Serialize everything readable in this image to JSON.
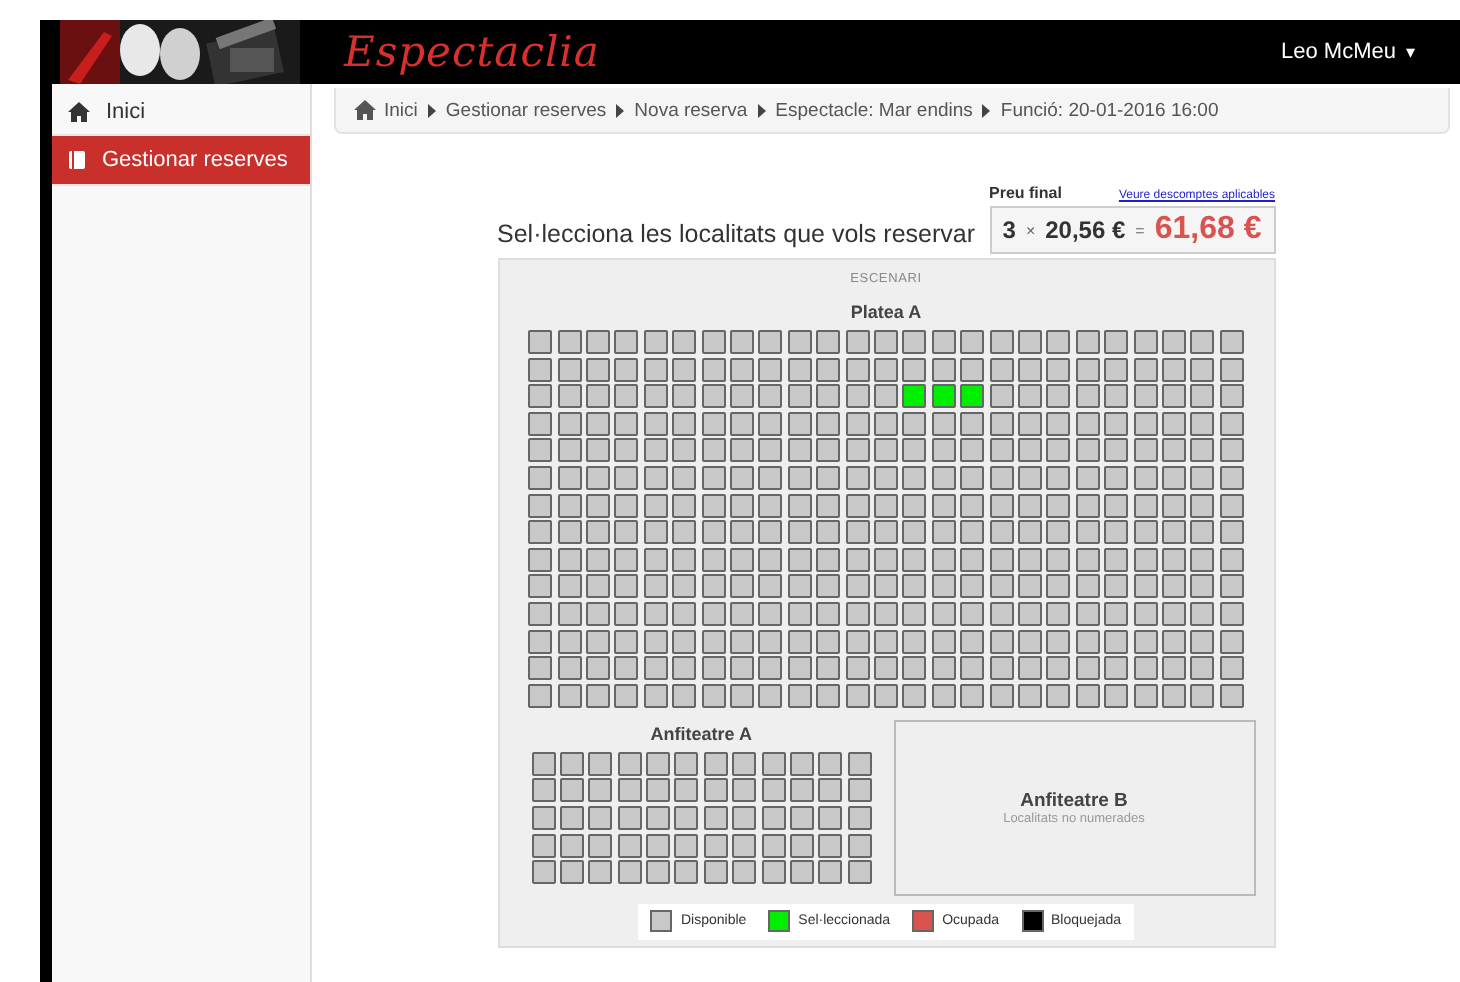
{
  "header": {
    "brand": "Espectaclia",
    "user": "Leo McMeu",
    "user_caret": "▾"
  },
  "sidebar": {
    "items": [
      {
        "label": "Inici",
        "selected": false
      },
      {
        "label": "Gestionar reserves",
        "selected": true
      }
    ]
  },
  "breadcrumb": [
    {
      "label": "Inici"
    },
    {
      "label": "Gestionar reserves"
    },
    {
      "label": "Nova reserva"
    },
    {
      "label": "Espectacle: Mar endins"
    },
    {
      "label": "Funció: 20-01-2016 16:00"
    }
  ],
  "heading": "Sel·lecciona les localitats que vols reservar",
  "price": {
    "label": "Preu final",
    "link": "Veure descomptes aplicables",
    "quantity": "3",
    "times": "×",
    "unit_price": "20,56 €",
    "equals": "=",
    "total": "61,68 €"
  },
  "stage": "ESCENARI",
  "platea": {
    "title": "Platea A",
    "rows": [
      [
        {
          "selected": false
        },
        {
          "selected": false
        },
        {
          "selected": false
        },
        {
          "selected": false
        },
        {
          "selected": false
        },
        {
          "selected": false
        },
        {
          "selected": false
        },
        {
          "selected": false
        },
        {
          "selected": false
        },
        {
          "selected": false
        },
        {
          "selected": false
        },
        {
          "selected": false
        },
        {
          "selected": false
        },
        {
          "selected": false
        },
        {
          "selected": false
        },
        {
          "selected": false
        },
        {
          "selected": false
        },
        {
          "selected": false
        },
        {
          "selected": false
        },
        {
          "selected": false
        },
        {
          "selected": false
        },
        {
          "selected": false
        },
        {
          "selected": false
        },
        {
          "selected": false
        },
        {
          "selected": false
        }
      ],
      [
        {
          "selected": false
        },
        {
          "selected": false
        },
        {
          "selected": false
        },
        {
          "selected": false
        },
        {
          "selected": false
        },
        {
          "selected": false
        },
        {
          "selected": false
        },
        {
          "selected": false
        },
        {
          "selected": false
        },
        {
          "selected": false
        },
        {
          "selected": false
        },
        {
          "selected": false
        },
        {
          "selected": false
        },
        {
          "selected": false
        },
        {
          "selected": false
        },
        {
          "selected": false
        },
        {
          "selected": false
        },
        {
          "selected": false
        },
        {
          "selected": false
        },
        {
          "selected": false
        },
        {
          "selected": false
        },
        {
          "selected": false
        },
        {
          "selected": false
        },
        {
          "selected": false
        },
        {
          "selected": false
        }
      ],
      [
        {
          "selected": false
        },
        {
          "selected": false
        },
        {
          "selected": false
        },
        {
          "selected": false
        },
        {
          "selected": false
        },
        {
          "selected": false
        },
        {
          "selected": false
        },
        {
          "selected": false
        },
        {
          "selected": false
        },
        {
          "selected": false
        },
        {
          "selected": false
        },
        {
          "selected": false
        },
        {
          "selected": false
        },
        {
          "selected": true
        },
        {
          "selected": true
        },
        {
          "selected": true
        },
        {
          "selected": false
        },
        {
          "selected": false
        },
        {
          "selected": false
        },
        {
          "selected": false
        },
        {
          "selected": false
        },
        {
          "selected": false
        },
        {
          "selected": false
        },
        {
          "selected": false
        },
        {
          "selected": false
        }
      ],
      [
        {
          "selected": false
        },
        {
          "selected": false
        },
        {
          "selected": false
        },
        {
          "selected": false
        },
        {
          "selected": false
        },
        {
          "selected": false
        },
        {
          "selected": false
        },
        {
          "selected": false
        },
        {
          "selected": false
        },
        {
          "selected": false
        },
        {
          "selected": false
        },
        {
          "selected": false
        },
        {
          "selected": false
        },
        {
          "selected": false
        },
        {
          "selected": false
        },
        {
          "selected": false
        },
        {
          "selected": false
        },
        {
          "selected": false
        },
        {
          "selected": false
        },
        {
          "selected": false
        },
        {
          "selected": false
        },
        {
          "selected": false
        },
        {
          "selected": false
        },
        {
          "selected": false
        },
        {
          "selected": false
        }
      ],
      [
        {
          "selected": false
        },
        {
          "selected": false
        },
        {
          "selected": false
        },
        {
          "selected": false
        },
        {
          "selected": false
        },
        {
          "selected": false
        },
        {
          "selected": false
        },
        {
          "selected": false
        },
        {
          "selected": false
        },
        {
          "selected": false
        },
        {
          "selected": false
        },
        {
          "selected": false
        },
        {
          "selected": false
        },
        {
          "selected": false
        },
        {
          "selected": false
        },
        {
          "selected": false
        },
        {
          "selected": false
        },
        {
          "selected": false
        },
        {
          "selected": false
        },
        {
          "selected": false
        },
        {
          "selected": false
        },
        {
          "selected": false
        },
        {
          "selected": false
        },
        {
          "selected": false
        },
        {
          "selected": false
        }
      ],
      [
        {
          "selected": false
        },
        {
          "selected": false
        },
        {
          "selected": false
        },
        {
          "selected": false
        },
        {
          "selected": false
        },
        {
          "selected": false
        },
        {
          "selected": false
        },
        {
          "selected": false
        },
        {
          "selected": false
        },
        {
          "selected": false
        },
        {
          "selected": false
        },
        {
          "selected": false
        },
        {
          "selected": false
        },
        {
          "selected": false
        },
        {
          "selected": false
        },
        {
          "selected": false
        },
        {
          "selected": false
        },
        {
          "selected": false
        },
        {
          "selected": false
        },
        {
          "selected": false
        },
        {
          "selected": false
        },
        {
          "selected": false
        },
        {
          "selected": false
        },
        {
          "selected": false
        },
        {
          "selected": false
        }
      ],
      [
        {
          "selected": false
        },
        {
          "selected": false
        },
        {
          "selected": false
        },
        {
          "selected": false
        },
        {
          "selected": false
        },
        {
          "selected": false
        },
        {
          "selected": false
        },
        {
          "selected": false
        },
        {
          "selected": false
        },
        {
          "selected": false
        },
        {
          "selected": false
        },
        {
          "selected": false
        },
        {
          "selected": false
        },
        {
          "selected": false
        },
        {
          "selected": false
        },
        {
          "selected": false
        },
        {
          "selected": false
        },
        {
          "selected": false
        },
        {
          "selected": false
        },
        {
          "selected": false
        },
        {
          "selected": false
        },
        {
          "selected": false
        },
        {
          "selected": false
        },
        {
          "selected": false
        },
        {
          "selected": false
        }
      ],
      [
        {
          "selected": false
        },
        {
          "selected": false
        },
        {
          "selected": false
        },
        {
          "selected": false
        },
        {
          "selected": false
        },
        {
          "selected": false
        },
        {
          "selected": false
        },
        {
          "selected": false
        },
        {
          "selected": false
        },
        {
          "selected": false
        },
        {
          "selected": false
        },
        {
          "selected": false
        },
        {
          "selected": false
        },
        {
          "selected": false
        },
        {
          "selected": false
        },
        {
          "selected": false
        },
        {
          "selected": false
        },
        {
          "selected": false
        },
        {
          "selected": false
        },
        {
          "selected": false
        },
        {
          "selected": false
        },
        {
          "selected": false
        },
        {
          "selected": false
        },
        {
          "selected": false
        },
        {
          "selected": false
        }
      ],
      [
        {
          "selected": false
        },
        {
          "selected": false
        },
        {
          "selected": false
        },
        {
          "selected": false
        },
        {
          "selected": false
        },
        {
          "selected": false
        },
        {
          "selected": false
        },
        {
          "selected": false
        },
        {
          "selected": false
        },
        {
          "selected": false
        },
        {
          "selected": false
        },
        {
          "selected": false
        },
        {
          "selected": false
        },
        {
          "selected": false
        },
        {
          "selected": false
        },
        {
          "selected": false
        },
        {
          "selected": false
        },
        {
          "selected": false
        },
        {
          "selected": false
        },
        {
          "selected": false
        },
        {
          "selected": false
        },
        {
          "selected": false
        },
        {
          "selected": false
        },
        {
          "selected": false
        },
        {
          "selected": false
        }
      ],
      [
        {
          "selected": false
        },
        {
          "selected": false
        },
        {
          "selected": false
        },
        {
          "selected": false
        },
        {
          "selected": false
        },
        {
          "selected": false
        },
        {
          "selected": false
        },
        {
          "selected": false
        },
        {
          "selected": false
        },
        {
          "selected": false
        },
        {
          "selected": false
        },
        {
          "selected": false
        },
        {
          "selected": false
        },
        {
          "selected": false
        },
        {
          "selected": false
        },
        {
          "selected": false
        },
        {
          "selected": false
        },
        {
          "selected": false
        },
        {
          "selected": false
        },
        {
          "selected": false
        },
        {
          "selected": false
        },
        {
          "selected": false
        },
        {
          "selected": false
        },
        {
          "selected": false
        },
        {
          "selected": false
        }
      ],
      [
        {
          "selected": false
        },
        {
          "selected": false
        },
        {
          "selected": false
        },
        {
          "selected": false
        },
        {
          "selected": false
        },
        {
          "selected": false
        },
        {
          "selected": false
        },
        {
          "selected": false
        },
        {
          "selected": false
        },
        {
          "selected": false
        },
        {
          "selected": false
        },
        {
          "selected": false
        },
        {
          "selected": false
        },
        {
          "selected": false
        },
        {
          "selected": false
        },
        {
          "selected": false
        },
        {
          "selected": false
        },
        {
          "selected": false
        },
        {
          "selected": false
        },
        {
          "selected": false
        },
        {
          "selected": false
        },
        {
          "selected": false
        },
        {
          "selected": false
        },
        {
          "selected": false
        },
        {
          "selected": false
        }
      ],
      [
        {
          "selected": false
        },
        {
          "selected": false
        },
        {
          "selected": false
        },
        {
          "selected": false
        },
        {
          "selected": false
        },
        {
          "selected": false
        },
        {
          "selected": false
        },
        {
          "selected": false
        },
        {
          "selected": false
        },
        {
          "selected": false
        },
        {
          "selected": false
        },
        {
          "selected": false
        },
        {
          "selected": false
        },
        {
          "selected": false
        },
        {
          "selected": false
        },
        {
          "selected": false
        },
        {
          "selected": false
        },
        {
          "selected": false
        },
        {
          "selected": false
        },
        {
          "selected": false
        },
        {
          "selected": false
        },
        {
          "selected": false
        },
        {
          "selected": false
        },
        {
          "selected": false
        },
        {
          "selected": false
        }
      ],
      [
        {
          "selected": false
        },
        {
          "selected": false
        },
        {
          "selected": false
        },
        {
          "selected": false
        },
        {
          "selected": false
        },
        {
          "selected": false
        },
        {
          "selected": false
        },
        {
          "selected": false
        },
        {
          "selected": false
        },
        {
          "selected": false
        },
        {
          "selected": false
        },
        {
          "selected": false
        },
        {
          "selected": false
        },
        {
          "selected": false
        },
        {
          "selected": false
        },
        {
          "selected": false
        },
        {
          "selected": false
        },
        {
          "selected": false
        },
        {
          "selected": false
        },
        {
          "selected": false
        },
        {
          "selected": false
        },
        {
          "selected": false
        },
        {
          "selected": false
        },
        {
          "selected": false
        },
        {
          "selected": false
        }
      ],
      [
        {
          "selected": false
        },
        {
          "selected": false
        },
        {
          "selected": false
        },
        {
          "selected": false
        },
        {
          "selected": false
        },
        {
          "selected": false
        },
        {
          "selected": false
        },
        {
          "selected": false
        },
        {
          "selected": false
        },
        {
          "selected": false
        },
        {
          "selected": false
        },
        {
          "selected": false
        },
        {
          "selected": false
        },
        {
          "selected": false
        },
        {
          "selected": false
        },
        {
          "selected": false
        },
        {
          "selected": false
        },
        {
          "selected": false
        },
        {
          "selected": false
        },
        {
          "selected": false
        },
        {
          "selected": false
        },
        {
          "selected": false
        },
        {
          "selected": false
        },
        {
          "selected": false
        },
        {
          "selected": false
        }
      ]
    ]
  },
  "amfi_a": {
    "title": "Anfiteatre A",
    "rows": [
      [
        {
          "selected": false
        },
        {
          "selected": false
        },
        {
          "selected": false
        },
        {
          "selected": false
        },
        {
          "selected": false
        },
        {
          "selected": false
        },
        {
          "selected": false
        },
        {
          "selected": false
        },
        {
          "selected": false
        },
        {
          "selected": false
        },
        {
          "selected": false
        },
        {
          "selected": false
        }
      ],
      [
        {
          "selected": false
        },
        {
          "selected": false
        },
        {
          "selected": false
        },
        {
          "selected": false
        },
        {
          "selected": false
        },
        {
          "selected": false
        },
        {
          "selected": false
        },
        {
          "selected": false
        },
        {
          "selected": false
        },
        {
          "selected": false
        },
        {
          "selected": false
        },
        {
          "selected": false
        }
      ],
      [
        {
          "selected": false
        },
        {
          "selected": false
        },
        {
          "selected": false
        },
        {
          "selected": false
        },
        {
          "selected": false
        },
        {
          "selected": false
        },
        {
          "selected": false
        },
        {
          "selected": false
        },
        {
          "selected": false
        },
        {
          "selected": false
        },
        {
          "selected": false
        },
        {
          "selected": false
        }
      ],
      [
        {
          "selected": false
        },
        {
          "selected": false
        },
        {
          "selected": false
        },
        {
          "selected": false
        },
        {
          "selected": false
        },
        {
          "selected": false
        },
        {
          "selected": false
        },
        {
          "selected": false
        },
        {
          "selected": false
        },
        {
          "selected": false
        },
        {
          "selected": false
        },
        {
          "selected": false
        }
      ],
      [
        {
          "selected": false
        },
        {
          "selected": false
        },
        {
          "selected": false
        },
        {
          "selected": false
        },
        {
          "selected": false
        },
        {
          "selected": false
        },
        {
          "selected": false
        },
        {
          "selected": false
        },
        {
          "selected": false
        },
        {
          "selected": false
        },
        {
          "selected": false
        },
        {
          "selected": false
        }
      ]
    ]
  },
  "amfi_b": {
    "title": "Anfiteatre B",
    "note": "Localitats no numerades"
  },
  "legend": [
    {
      "label": "Disponible",
      "color": "#c8c8c8"
    },
    {
      "label": "Sel·leccionada",
      "color": "#00ee00"
    },
    {
      "label": "Ocupada",
      "color": "#d9534f"
    },
    {
      "label": "Bloquejada",
      "color": "#000000"
    }
  ]
}
